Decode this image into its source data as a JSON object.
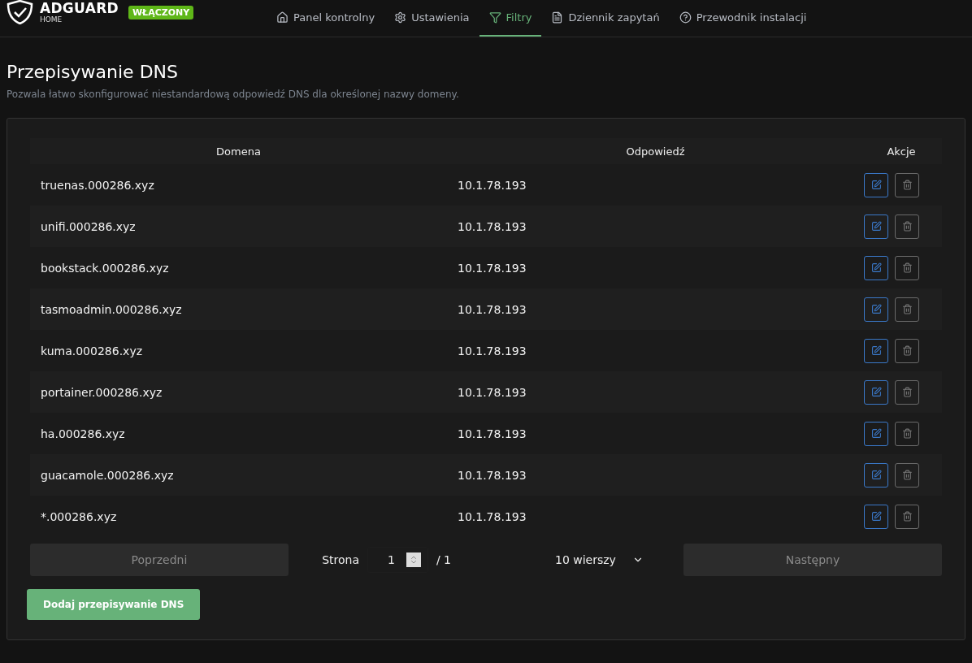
{
  "header": {
    "logo_title": "ADGUARD",
    "logo_subtitle": "HOME",
    "status_badge": "WŁĄCZONY"
  },
  "nav": [
    {
      "label": "Panel kontrolny",
      "selected": false
    },
    {
      "label": "Ustawienia",
      "selected": false
    },
    {
      "label": "Filtry",
      "selected": true
    },
    {
      "label": "Dziennik zapytań",
      "selected": false
    },
    {
      "label": "Przewodnik instalacji",
      "selected": false
    }
  ],
  "page": {
    "title": "Przepisywanie DNS",
    "description": "Pozwala łatwo skonfigurować niestandardową odpowiedź DNS dla określonej nazwy domeny."
  },
  "table": {
    "columns": [
      "Domena",
      "Odpowiedź",
      "Akcje"
    ],
    "rows": [
      {
        "domain": "truenas.000286.xyz",
        "answer": "10.1.78.193"
      },
      {
        "domain": "unifi.000286.xyz",
        "answer": "10.1.78.193"
      },
      {
        "domain": "bookstack.000286.xyz",
        "answer": "10.1.78.193"
      },
      {
        "domain": "tasmoadmin.000286.xyz",
        "answer": "10.1.78.193"
      },
      {
        "domain": "kuma.000286.xyz",
        "answer": "10.1.78.193"
      },
      {
        "domain": "portainer.000286.xyz",
        "answer": "10.1.78.193"
      },
      {
        "domain": "ha.000286.xyz",
        "answer": "10.1.78.193"
      },
      {
        "domain": "guacamole.000286.xyz",
        "answer": "10.1.78.193"
      },
      {
        "domain": "*.000286.xyz",
        "answer": "10.1.78.193"
      }
    ]
  },
  "pagination": {
    "previous": {
      "label": "Poprzedni",
      "disabled": true
    },
    "page_label": "Strona",
    "page_value": "1",
    "page_total": "/ 1",
    "rows_select": "10 wierszy",
    "next": {
      "label": "Następny",
      "disabled": true
    }
  },
  "add_button": "Dodaj przepisywanie DNS"
}
